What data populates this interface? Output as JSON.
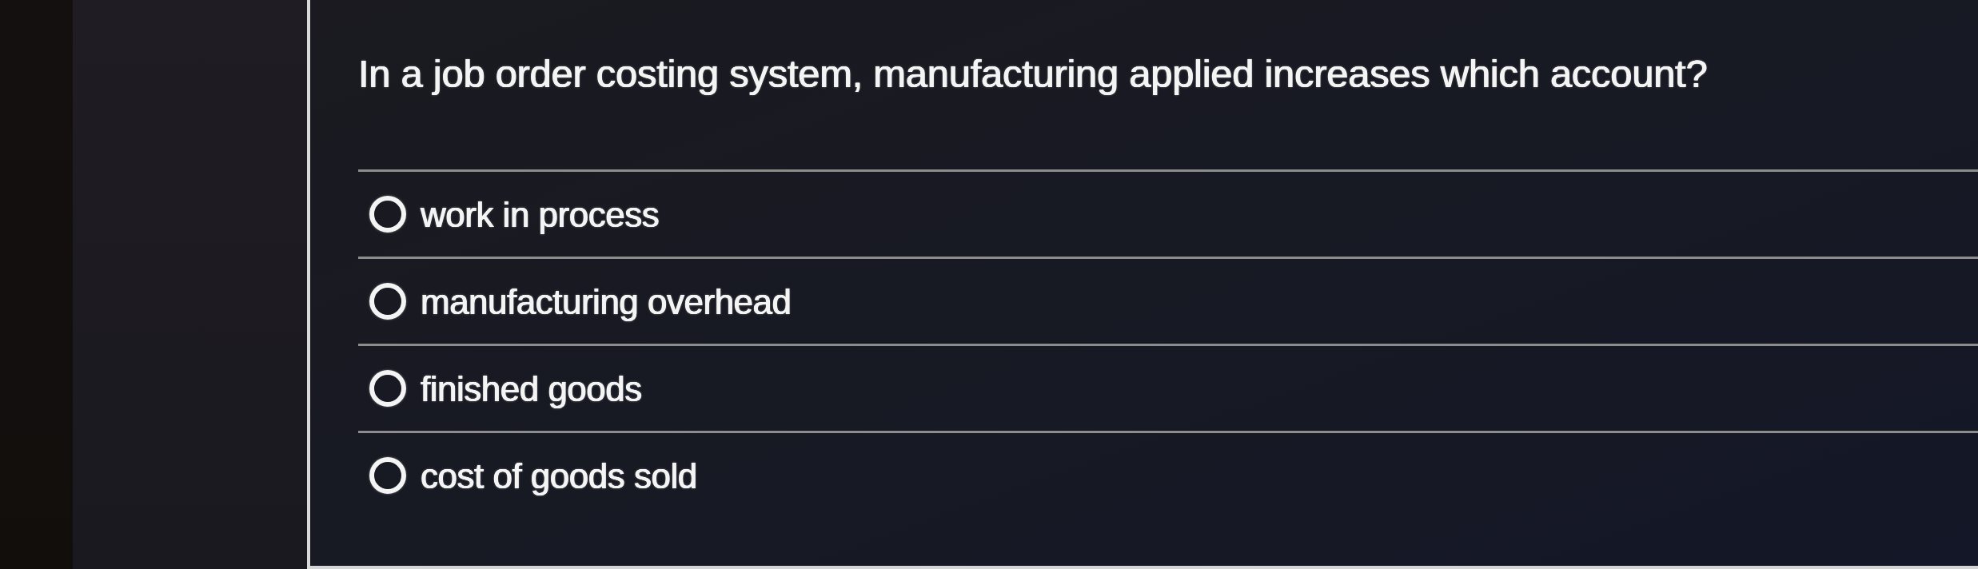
{
  "question": {
    "text": "In a job order costing system, manufacturing applied increases which account?"
  },
  "options": [
    {
      "label": "work in process",
      "selected": false
    },
    {
      "label": "manufacturing overhead",
      "selected": false
    },
    {
      "label": "finished goods",
      "selected": false
    },
    {
      "label": "cost of goods sold",
      "selected": false
    }
  ]
}
